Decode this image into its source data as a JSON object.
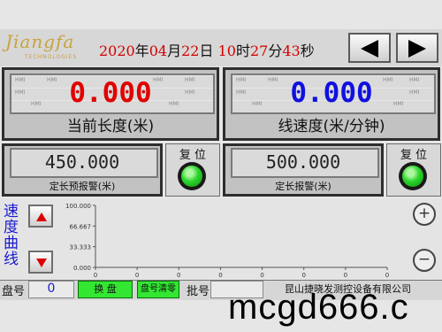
{
  "header": {
    "logo_text": "Jiangfa",
    "logo_sub": "TECHNOLOGIES",
    "datetime": {
      "year": "2020",
      "year_unit": "年",
      "month": "04",
      "month_unit": "月",
      "day": "22",
      "day_unit": "日",
      "hour": "10",
      "hour_unit": "时",
      "minute": "27",
      "minute_unit": "分",
      "second": "43",
      "second_unit": "秒"
    },
    "prev_icon": "left-triangle-icon",
    "next_icon": "right-triangle-icon"
  },
  "length_panel": {
    "value": "0.000",
    "label": "当前长度(米)",
    "watermark": "HMI",
    "value_color": "#e00000"
  },
  "speed_panel": {
    "value": "0.000",
    "label": "线速度(米/分钟)",
    "watermark": "HMI",
    "value_color": "#1010e0"
  },
  "prealarm_panel": {
    "value": "450.000",
    "label": "定长预报警(米)"
  },
  "alarm_panel": {
    "value": "500.000",
    "label": "定长报警(米)"
  },
  "reset": {
    "label": "复 位",
    "lamp_color": "#2cd52c"
  },
  "chart": {
    "title": "速度曲线",
    "up_icon": "red-up-arrow-icon",
    "down_icon": "red-down-arrow-icon",
    "zoom_in_label": "+",
    "zoom_out_label": "−"
  },
  "chart_data": {
    "type": "line",
    "title": "",
    "xlabel": "",
    "ylabel": "",
    "ylim": [
      0,
      100
    ],
    "y_ticks": [
      "100.000",
      "66.667",
      "33.333",
      "0.000"
    ],
    "x_ticks": [
      "0",
      "0",
      "0",
      "0",
      "0",
      "0",
      "0",
      "0"
    ],
    "series": [],
    "grid": false
  },
  "bottom": {
    "disc_no_label": "盘号",
    "disc_no_value": "0",
    "change_disc_label": "换 盘",
    "clear_disc_label": "盘号清零",
    "batch_no_label": "批号",
    "batch_no_value": "",
    "company": "昆山捷晓发测控设备有限公司"
  },
  "watermark": "mcgd666.c"
}
